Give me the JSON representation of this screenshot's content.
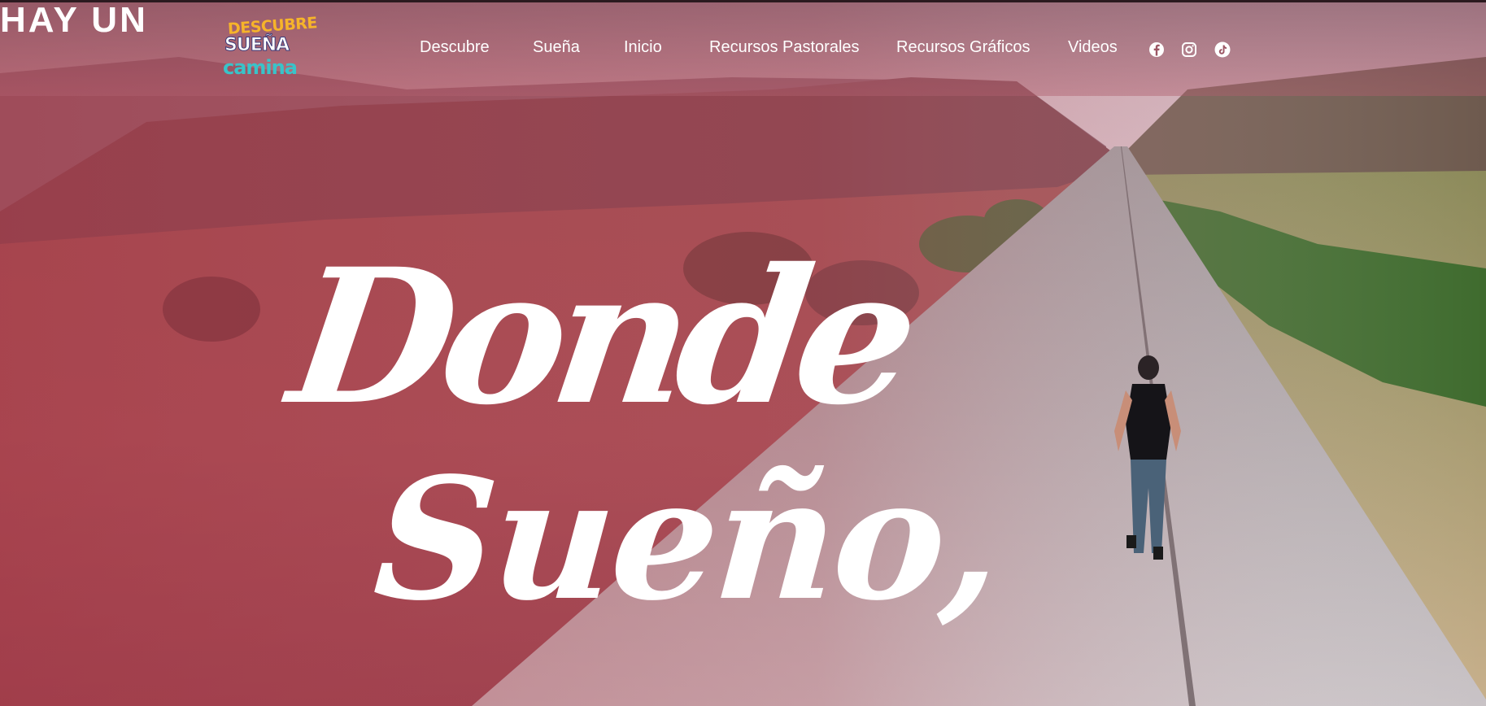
{
  "logo": {
    "line1": "DESCUBRE",
    "line2": "SUEÑA",
    "line3": "camina"
  },
  "nav": {
    "items": [
      {
        "label": "Descubre"
      },
      {
        "label": "Sueña"
      },
      {
        "label": "Inicio"
      },
      {
        "label": "Recursos Pastorales"
      },
      {
        "label": "Recursos Gráficos"
      },
      {
        "label": "Videos"
      }
    ]
  },
  "social": [
    {
      "icon": "facebook-icon"
    },
    {
      "icon": "instagram-icon"
    },
    {
      "icon": "tiktok-icon"
    }
  ],
  "hero": {
    "line1": "Donde",
    "line2": "HAY UN",
    "line3": "Sueño,"
  },
  "colors": {
    "overlay": "#b0505e",
    "text": "#ffffff",
    "logo_yellow": "#f6b42a",
    "logo_teal": "#39c3c9"
  }
}
